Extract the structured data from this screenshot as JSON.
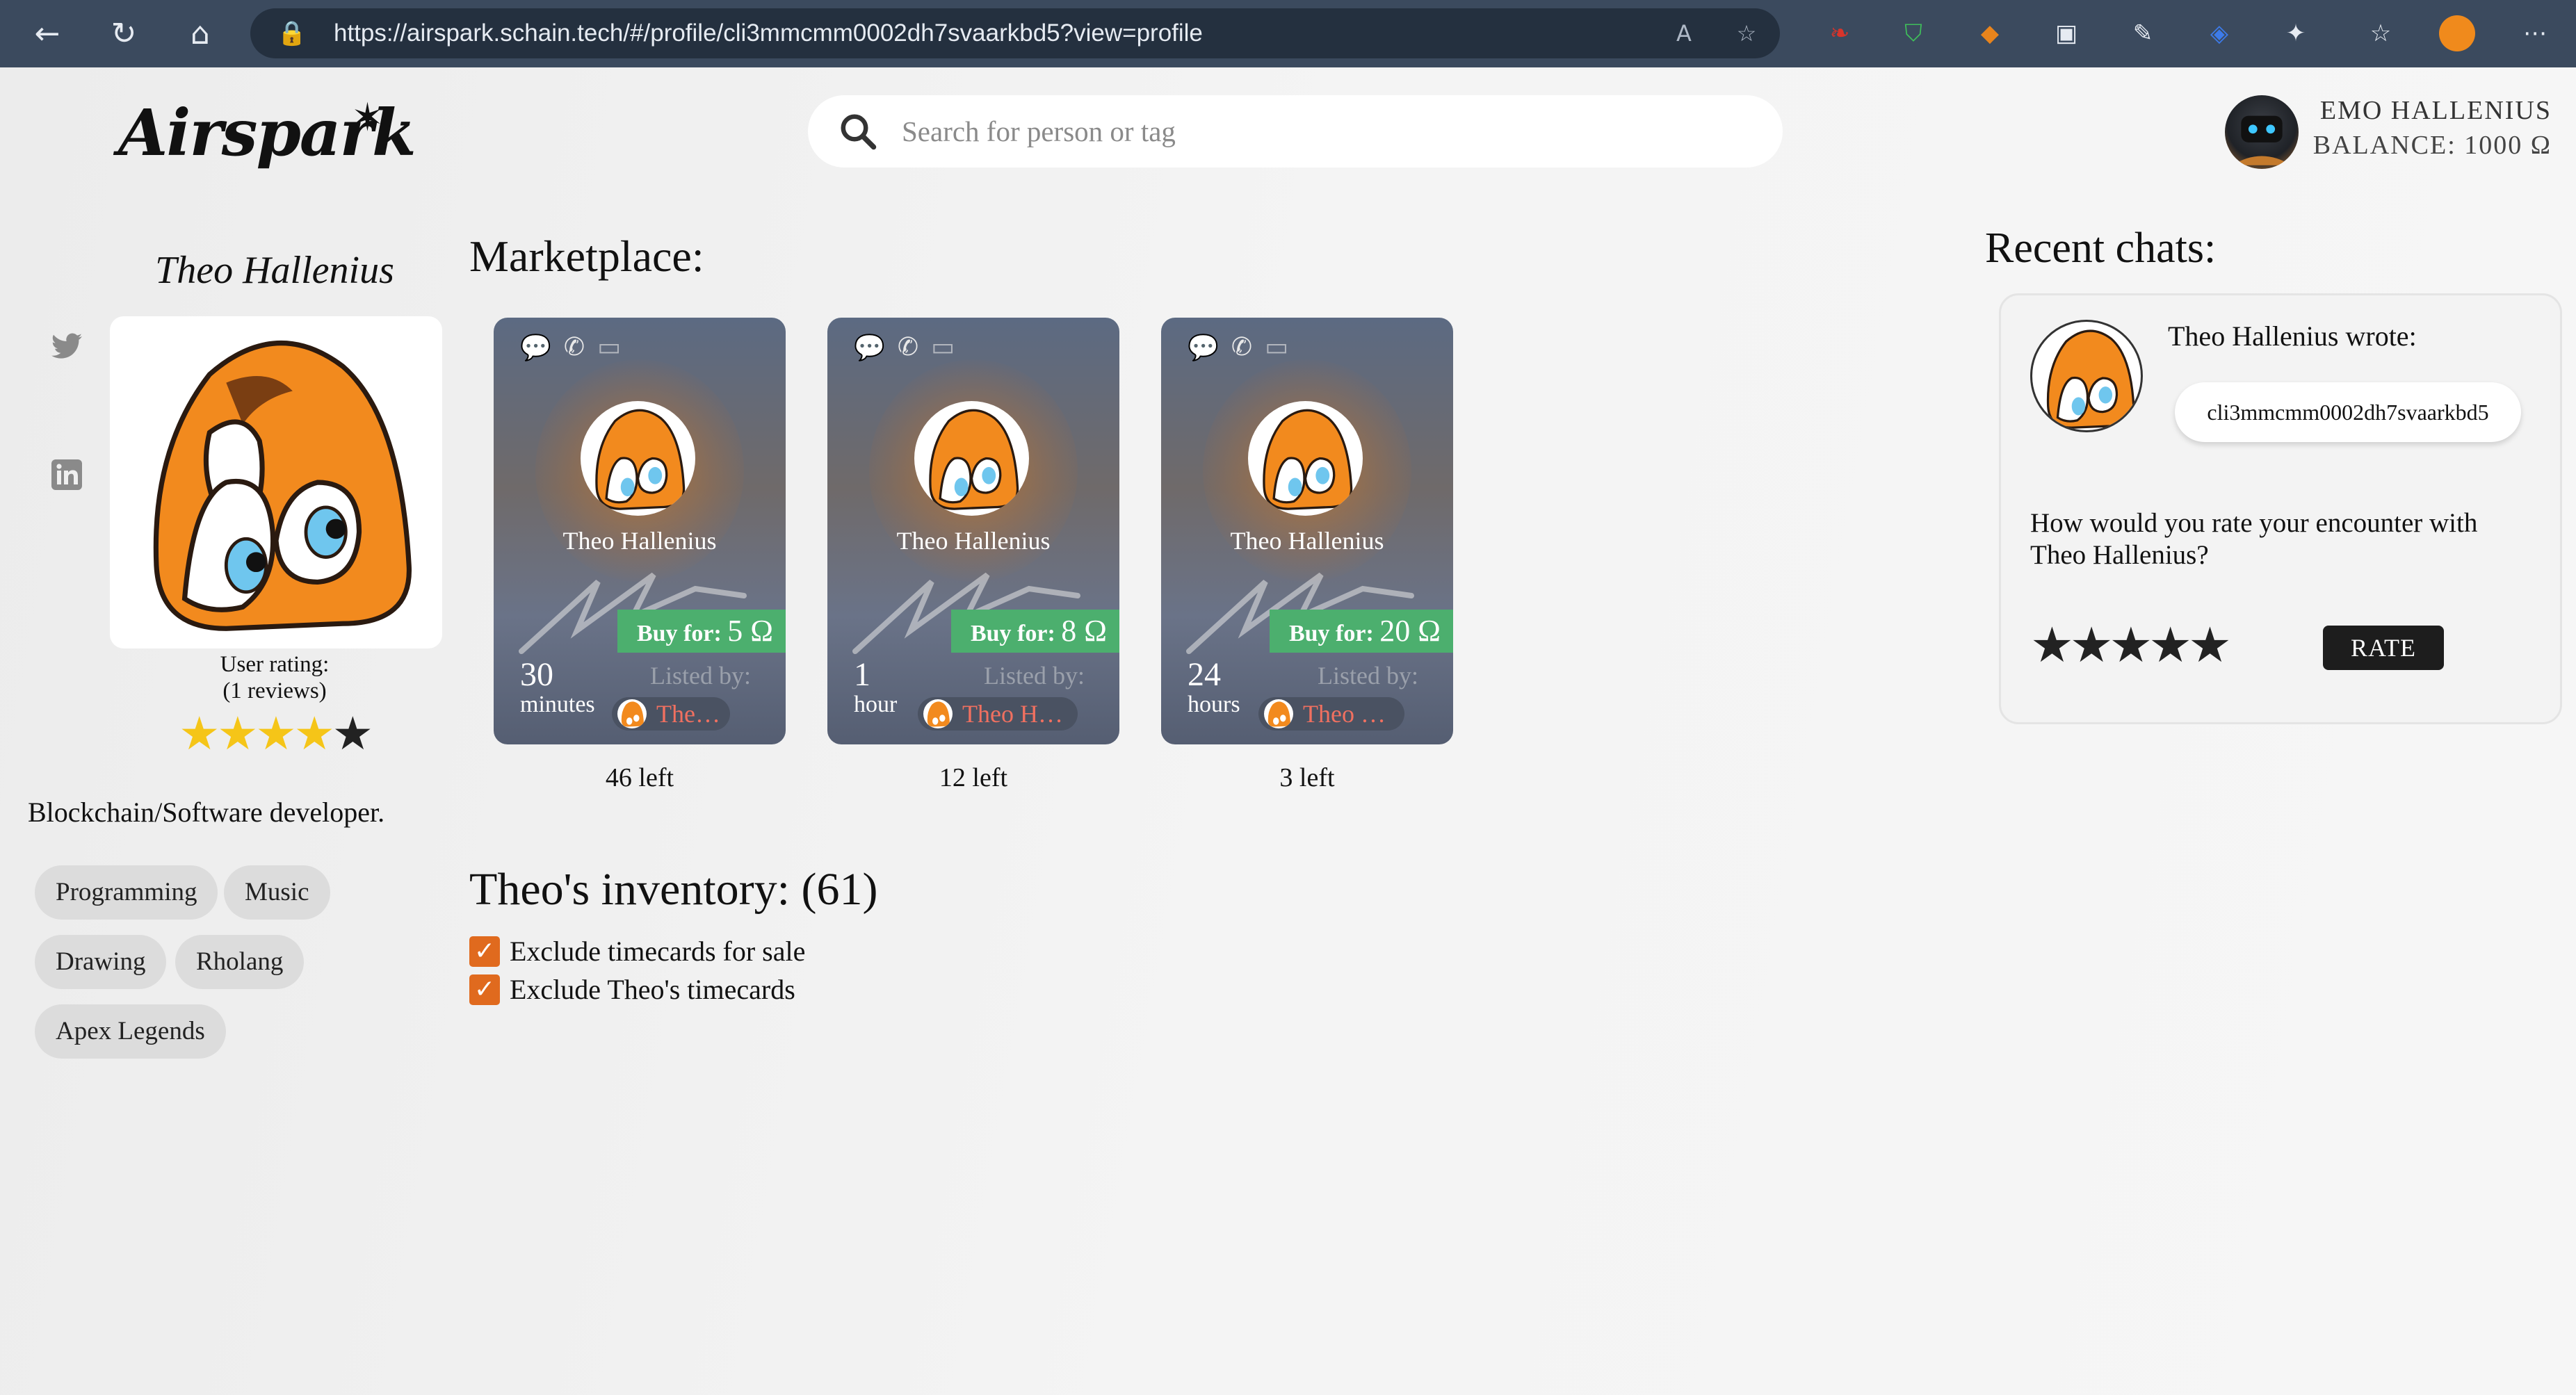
{
  "browser": {
    "url": "https://airspark.schain.tech/#/profile/cli3mmcmm0002dh7svaarkbd5?view=profile"
  },
  "header": {
    "logo_text": "Airspark",
    "search_placeholder": "Search for person or tag",
    "user_name": "EMO HALLENIUS",
    "balance": "BALANCE: 1000 Ω"
  },
  "profile": {
    "name": "Theo Hallenius",
    "rating_label_1": "User rating:",
    "rating_label_2": "(1 reviews)",
    "rating_value": 4,
    "rating_max": 5,
    "bio": "Blockchain/Software developer.",
    "tags": [
      "Programming",
      "Music",
      "Drawing",
      "Rholang",
      "Apex Legends"
    ]
  },
  "marketplace": {
    "title": "Marketplace:",
    "cards": [
      {
        "name": "Theo Hallenius",
        "buy_label": "Buy for:",
        "price": "5 Ω",
        "duration_num": "30",
        "duration_unit": "minutes",
        "listed_label": "Listed by:",
        "lister": "Theo…",
        "left": "46 left"
      },
      {
        "name": "Theo Hallenius",
        "buy_label": "Buy for:",
        "price": "8 Ω",
        "duration_num": "1",
        "duration_unit": "hour",
        "listed_label": "Listed by:",
        "lister": "Theo H…",
        "left": "12 left"
      },
      {
        "name": "Theo Hallenius",
        "buy_label": "Buy for:",
        "price": "20 Ω",
        "duration_num": "24",
        "duration_unit": "hours",
        "listed_label": "Listed by:",
        "lister": "Theo …",
        "left": "3 left"
      }
    ]
  },
  "inventory": {
    "title": "Theo's inventory: (61)",
    "checks": [
      "Exclude timecards for sale",
      "Exclude Theo's timecards"
    ]
  },
  "chats": {
    "title": "Recent chats:",
    "from": "Theo Hallenius wrote:",
    "message": "cli3mmcmm0002dh7svaarkbd5",
    "question": "How would you rate your encounter with Theo Hallenius?",
    "rate_label": "RATE",
    "stars": 5
  },
  "colors": {
    "accent_orange": "#e06a1e",
    "buy_green": "#4caf6e",
    "lister_red": "#f07060",
    "chrome_bg": "#3b4a5e"
  }
}
